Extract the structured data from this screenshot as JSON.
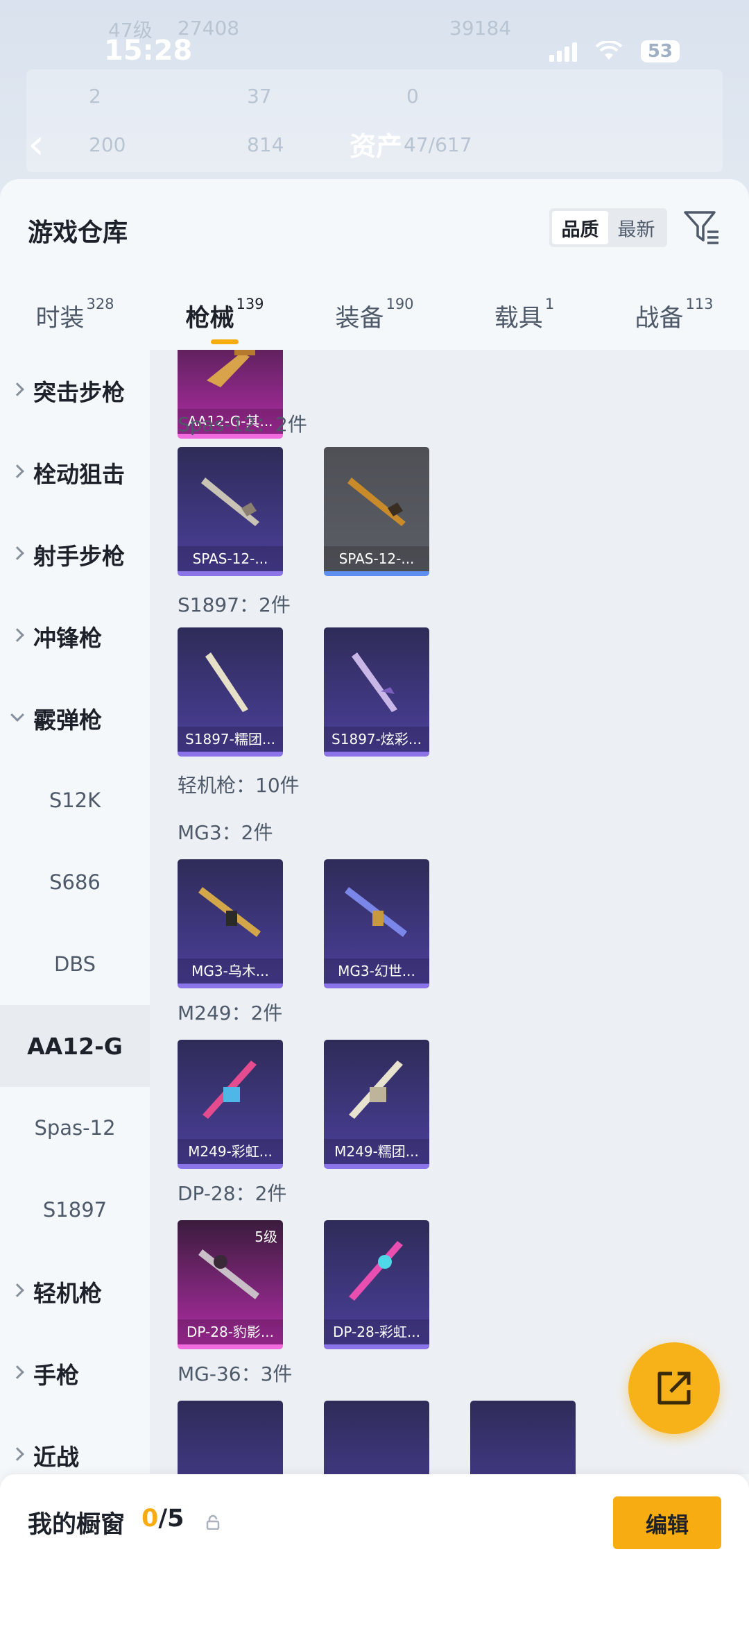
{
  "status_bar": {
    "time": "15:28",
    "battery": "53"
  },
  "background": {
    "level": "47级",
    "stat_a": "27408",
    "stat_b": "39184",
    "counters": [
      "2",
      "37",
      "0",
      "200",
      "814"
    ],
    "assets_label": "资产",
    "assets_value": "47/617"
  },
  "sheet": {
    "title": "游戏仓库"
  },
  "sort": {
    "options": [
      "品质",
      "最新"
    ],
    "active": "品质"
  },
  "tabs": [
    {
      "label": "时装",
      "count": "328"
    },
    {
      "label": "枪械",
      "count": "139",
      "active": true
    },
    {
      "label": "装备",
      "count": "190"
    },
    {
      "label": "载具",
      "count": "1"
    },
    {
      "label": "战备",
      "count": "113"
    }
  ],
  "categories": [
    {
      "label": "突击步枪",
      "type": "parent",
      "expanded": false
    },
    {
      "label": "栓动狙击",
      "type": "parent",
      "expanded": false
    },
    {
      "label": "射手步枪",
      "type": "parent",
      "expanded": false
    },
    {
      "label": "冲锋枪",
      "type": "parent",
      "expanded": false
    },
    {
      "label": "霰弹枪",
      "type": "parent",
      "expanded": true
    },
    {
      "label": "S12K",
      "type": "child"
    },
    {
      "label": "S686",
      "type": "child"
    },
    {
      "label": "DBS",
      "type": "child"
    },
    {
      "label": "AA12-G",
      "type": "child",
      "selected": true
    },
    {
      "label": "Spas-12",
      "type": "child"
    },
    {
      "label": "S1897",
      "type": "child"
    },
    {
      "label": "轻机枪",
      "type": "parent",
      "expanded": false
    },
    {
      "label": "手枪",
      "type": "parent",
      "expanded": false
    },
    {
      "label": "近战",
      "type": "parent",
      "expanded": false
    }
  ],
  "groups": {
    "top_card": "AA12-G-其...",
    "spas_label": "Spas-12：2件",
    "spas_cards": [
      "SPAS-12-...",
      "SPAS-12-..."
    ],
    "s1897_label": "S1897：2件",
    "s1897_cards": [
      "S1897-糯团...",
      "S1897-炫彩..."
    ],
    "lmg_label": "轻机枪：10件",
    "mg3_label": "MG3：2件",
    "mg3_cards": [
      "MG3-乌木...",
      "MG3-幻世..."
    ],
    "m249_label": "M249：2件",
    "m249_cards": [
      "M249-彩虹...",
      "M249-糯团..."
    ],
    "dp28_label": "DP-28：2件",
    "dp28_cards": [
      "DP-28-豹影...",
      "DP-28-彩虹..."
    ],
    "dp28_level": "5级",
    "mg36_label": "MG-36：3件"
  },
  "showcase": {
    "title": "我的橱窗",
    "current": "0",
    "total": "/5",
    "edit_label": "编辑"
  },
  "colors": {
    "accent": "#f7ad12",
    "card_purple": "#4b3f9a",
    "card_pink": "#b02da4",
    "card_grey": "#5b5e65"
  }
}
